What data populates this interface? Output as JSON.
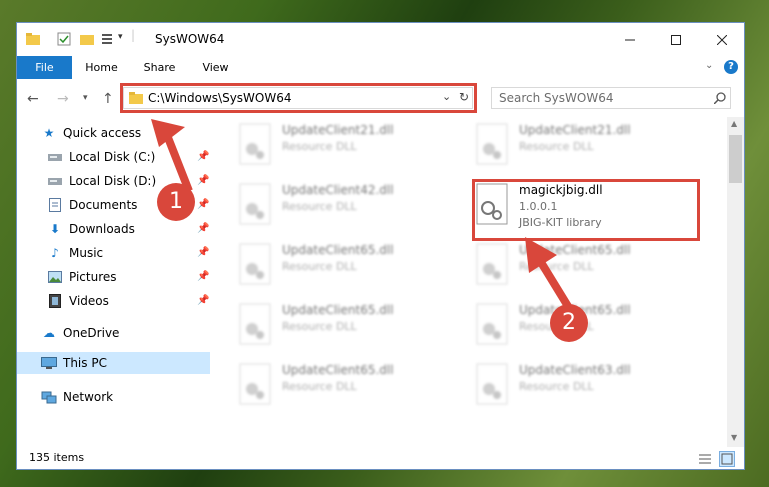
{
  "window": {
    "title": "SysWOW64"
  },
  "ribbon": {
    "tabs": [
      "File",
      "Home",
      "Share",
      "View"
    ]
  },
  "address": {
    "path": "C:\\Windows\\SysWOW64",
    "search_placeholder": "Search SysWOW64"
  },
  "nav": {
    "quick_access": "Quick access",
    "items": [
      {
        "label": "Local Disk (C:)",
        "icon": "drive-icon"
      },
      {
        "label": "Local Disk (D:)",
        "icon": "drive-icon"
      },
      {
        "label": "Documents",
        "icon": "documents-icon"
      },
      {
        "label": "Downloads",
        "icon": "downloads-icon"
      },
      {
        "label": "Music",
        "icon": "music-icon"
      },
      {
        "label": "Pictures",
        "icon": "pictures-icon"
      },
      {
        "label": "Videos",
        "icon": "videos-icon"
      }
    ],
    "onedrive": "OneDrive",
    "this_pc": "This PC",
    "network": "Network"
  },
  "files": {
    "left": [
      {
        "name": "UpdateClient21.dll",
        "type": "Resource DLL"
      },
      {
        "name": "UpdateClient42.dll",
        "type": "Resource DLL"
      },
      {
        "name": "UpdateClient65.dll",
        "type": "Resource DLL"
      },
      {
        "name": "UpdateClient65.dll",
        "type": "Resource DLL"
      },
      {
        "name": "UpdateClient65.dll",
        "type": "Resource DLL"
      }
    ],
    "right": [
      {
        "name": "UpdateClient21.dll",
        "type": "Resource DLL"
      },
      {
        "name": "UpdateClient65.dll",
        "type": "Resource DLL"
      },
      {
        "name": "UpdateClient65.dll",
        "type": "Resource DLL"
      },
      {
        "name": "UpdateClient63.dll",
        "type": "Resource DLL"
      }
    ],
    "highlight": {
      "name": "magickjbig.dll",
      "version": "1.0.0.1",
      "description": "JBIG-KIT library"
    }
  },
  "status": {
    "count": "135 items"
  },
  "annotations": {
    "step1": "1",
    "step2": "2",
    "color": "#d9473b"
  }
}
